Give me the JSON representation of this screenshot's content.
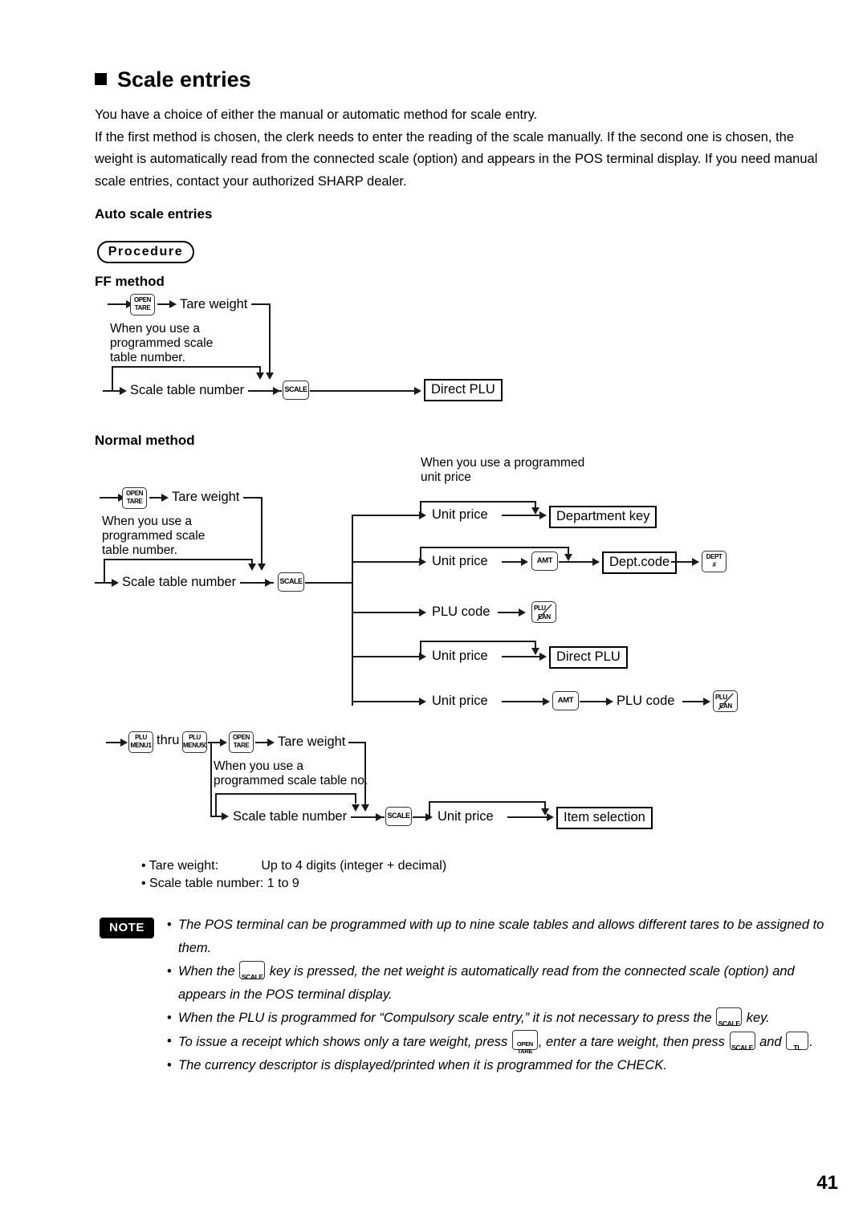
{
  "page": {
    "number": "41",
    "section_title": "Scale entries",
    "intro": [
      "You have a choice of either the manual or automatic method for scale entry.",
      "If the first method is chosen, the clerk needs to enter the reading of the scale manually.  If the second one is chosen, the weight is automatically read from the connected scale (option) and appears in the POS terminal display. If you need manual scale entries, contact your authorized SHARP dealer."
    ],
    "auto_scale_heading": "Auto scale entries",
    "procedure_badge": "Procedure"
  },
  "ff_method": {
    "heading": "FF method",
    "open_tare_key": {
      "line1": "OPEN",
      "line2": "TARE"
    },
    "tare_weight": "Tare weight",
    "note_programmed": "When you use a\nprogrammed scale\ntable number.",
    "note_line1": "When you use a",
    "note_line2": "programmed scale",
    "note_line3": "table number.",
    "scale_table_number": "Scale table number",
    "scale_key": "SCALE",
    "direct_plu": "Direct PLU"
  },
  "normal_method": {
    "heading": "Normal method",
    "open_tare_key": {
      "line1": "OPEN",
      "line2": "TARE"
    },
    "tare_weight": "Tare weight",
    "note_line1": "When you use a",
    "note_line2": "programmed scale",
    "note_line3": "table number.",
    "scale_table_number": "Scale table number",
    "scale_key": "SCALE",
    "unit_price_note_line1": "When you use a programmed",
    "unit_price_note_line2": "unit price",
    "branches": {
      "b1_unit_price": "Unit price",
      "b1_department_key": "Department key",
      "b2_unit_price": "Unit price",
      "b2_amt_key": "AMT",
      "b2_dept_code": "Dept.code",
      "b2_dept_hash_key": {
        "line1": "DEPT",
        "line2": "#"
      },
      "b3_plu_code": "PLU code",
      "b3_plu_ean_key": {
        "line1": "PLU",
        "line2": "EAN"
      },
      "b4_unit_price": "Unit price",
      "b4_direct_plu": "Direct PLU",
      "b5_unit_price": "Unit price",
      "b5_amt_key": "AMT",
      "b5_plu_code": "PLU code",
      "b5_plu_ean_key": {
        "line1": "PLU",
        "line2": "EAN"
      }
    }
  },
  "menu_method": {
    "plu_menu1_key": {
      "line1": "PLU",
      "line2": "MENU1"
    },
    "thru_label": "thru",
    "plu_menu50_key": {
      "line1": "PLU",
      "line2": "MENU50"
    },
    "open_tare_key": {
      "line1": "OPEN",
      "line2": "TARE"
    },
    "tare_weight": "Tare weight",
    "note_line1": "When you use a",
    "note_line2": "programmed scale table no.",
    "scale_table_number": "Scale table number",
    "scale_key": "SCALE",
    "unit_price": "Unit price",
    "item_selection": "Item selection"
  },
  "spec_list": {
    "row1": "• Tare weight:            Up to 4 digits (integer + decimal)",
    "row2": "• Scale table number: 1 to 9"
  },
  "note": {
    "badge": "NOTE",
    "items": [
      {
        "t1": "The POS terminal can be programmed with up to nine scale tables and allows different tares to be assigned to them."
      },
      {
        "t1": "When the ",
        "key1": "SCALE",
        "t2": " key is pressed, the net weight is automatically read from the connected scale (option) and appears in the POS terminal display."
      },
      {
        "t1": "When the PLU is programmed for “Compulsory scale entry,” it is not necessary to press the ",
        "key1": "SCALE",
        "t2": " key."
      },
      {
        "t1": "To issue a receipt which shows only a tare weight, press ",
        "key1_l1": "OPEN",
        "key1_l2": "TARE",
        "t2": ", enter a tare weight, then press ",
        "key2": "SCALE",
        "t3": " and ",
        "key3": "TL",
        "t4": "."
      },
      {
        "t1": "The currency descriptor is displayed/printed when it is programmed for the CHECK."
      }
    ]
  }
}
